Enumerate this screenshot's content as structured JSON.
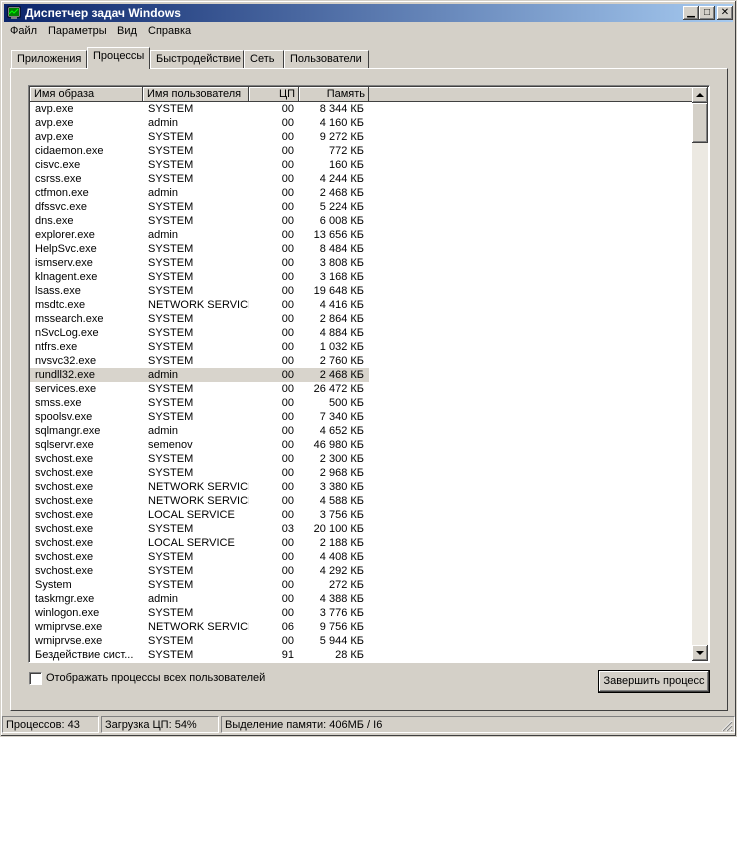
{
  "window": {
    "title": "Диспетчер задач Windows"
  },
  "menu": [
    "Файл",
    "Параметры",
    "Вид",
    "Справка"
  ],
  "tabs": [
    "Приложения",
    "Процессы",
    "Быстродействие",
    "Сеть",
    "Пользователи"
  ],
  "active_tab": "Процессы",
  "columns": [
    "Имя образа",
    "Имя пользователя",
    "ЦП",
    "Память"
  ],
  "processes": [
    [
      "avp.exe",
      "SYSTEM",
      "00",
      "8 344 КБ"
    ],
    [
      "avp.exe",
      "admin",
      "00",
      "4 160 КБ"
    ],
    [
      "avp.exe",
      "SYSTEM",
      "00",
      "9 272 КБ"
    ],
    [
      "cidaemon.exe",
      "SYSTEM",
      "00",
      "772 КБ"
    ],
    [
      "cisvc.exe",
      "SYSTEM",
      "00",
      "160 КБ"
    ],
    [
      "csrss.exe",
      "SYSTEM",
      "00",
      "4 244 КБ"
    ],
    [
      "ctfmon.exe",
      "admin",
      "00",
      "2 468 КБ"
    ],
    [
      "dfssvc.exe",
      "SYSTEM",
      "00",
      "5 224 КБ"
    ],
    [
      "dns.exe",
      "SYSTEM",
      "00",
      "6 008 КБ"
    ],
    [
      "explorer.exe",
      "admin",
      "00",
      "13 656 КБ"
    ],
    [
      "HelpSvc.exe",
      "SYSTEM",
      "00",
      "8 484 КБ"
    ],
    [
      "ismserv.exe",
      "SYSTEM",
      "00",
      "3 808 КБ"
    ],
    [
      "klnagent.exe",
      "SYSTEM",
      "00",
      "3 168 КБ"
    ],
    [
      "lsass.exe",
      "SYSTEM",
      "00",
      "19 648 КБ"
    ],
    [
      "msdtc.exe",
      "NETWORK SERVICE",
      "00",
      "4 416 КБ"
    ],
    [
      "mssearch.exe",
      "SYSTEM",
      "00",
      "2 864 КБ"
    ],
    [
      "nSvcLog.exe",
      "SYSTEM",
      "00",
      "4 884 КБ"
    ],
    [
      "ntfrs.exe",
      "SYSTEM",
      "00",
      "1 032 КБ"
    ],
    [
      "nvsvc32.exe",
      "SYSTEM",
      "00",
      "2 760 КБ"
    ],
    [
      "rundll32.exe",
      "admin",
      "00",
      "2 468 КБ"
    ],
    [
      "services.exe",
      "SYSTEM",
      "00",
      "26 472 КБ"
    ],
    [
      "smss.exe",
      "SYSTEM",
      "00",
      "500 КБ"
    ],
    [
      "spoolsv.exe",
      "SYSTEM",
      "00",
      "7 340 КБ"
    ],
    [
      "sqlmangr.exe",
      "admin",
      "00",
      "4 652 КБ"
    ],
    [
      "sqlservr.exe",
      "semenov",
      "00",
      "46 980 КБ"
    ],
    [
      "svchost.exe",
      "SYSTEM",
      "00",
      "2 300 КБ"
    ],
    [
      "svchost.exe",
      "SYSTEM",
      "00",
      "2 968 КБ"
    ],
    [
      "svchost.exe",
      "NETWORK SERVICE",
      "00",
      "3 380 КБ"
    ],
    [
      "svchost.exe",
      "NETWORK SERVICE",
      "00",
      "4 588 КБ"
    ],
    [
      "svchost.exe",
      "LOCAL SERVICE",
      "00",
      "3 756 КБ"
    ],
    [
      "svchost.exe",
      "SYSTEM",
      "03",
      "20 100 КБ"
    ],
    [
      "svchost.exe",
      "LOCAL SERVICE",
      "00",
      "2 188 КБ"
    ],
    [
      "svchost.exe",
      "SYSTEM",
      "00",
      "4 408 КБ"
    ],
    [
      "svchost.exe",
      "SYSTEM",
      "00",
      "4 292 КБ"
    ],
    [
      "System",
      "SYSTEM",
      "00",
      "272 КБ"
    ],
    [
      "taskmgr.exe",
      "admin",
      "00",
      "4 388 КБ"
    ],
    [
      "winlogon.exe",
      "SYSTEM",
      "00",
      "3 776 КБ"
    ],
    [
      "wmiprvse.exe",
      "NETWORK SERVICE",
      "06",
      "9 756 КБ"
    ],
    [
      "wmiprvse.exe",
      "SYSTEM",
      "00",
      "5 944 КБ"
    ],
    [
      "Бездействие сист...",
      "SYSTEM",
      "91",
      "28 КБ"
    ]
  ],
  "selected_process": "rundll32.exe",
  "show_all_label": "Отображать процессы всех пользователей",
  "end_process_label": "Завершить процесс",
  "status": {
    "processes": "Процессов: 43",
    "cpu": "Загрузка ЦП: 54%",
    "memory": "Выделение памяти: 406МБ / I6"
  },
  "colors": {
    "titlebar_start": "#0a246a",
    "titlebar_end": "#a6caf0",
    "face": "#d4d0c8",
    "selection": "#d8d4cc"
  }
}
